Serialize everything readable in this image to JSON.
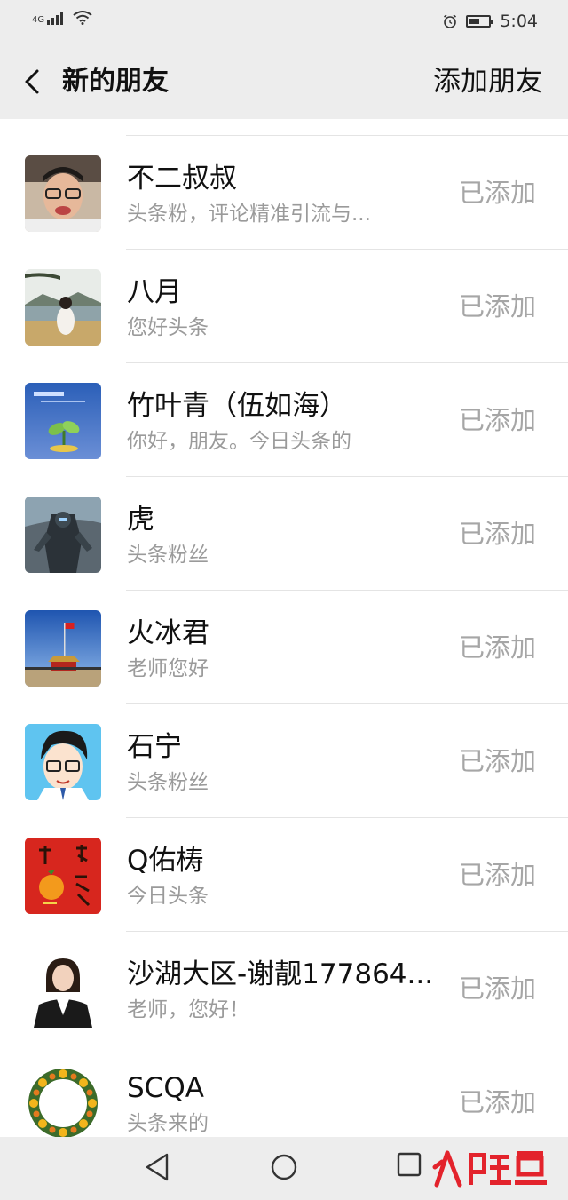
{
  "status_bar": {
    "network": "4G",
    "time": "5:04",
    "battery_level": 0.55
  },
  "nav": {
    "back_icon": "chevron-left-icon",
    "title": "新的朋友",
    "action": "添加朋友"
  },
  "contacts": [
    {
      "name": "不二叔叔",
      "message": "头条粉，评论精准引流与...",
      "status": "已添加",
      "avatar": "man-glasses-photo"
    },
    {
      "name": "八月",
      "message": "您好头条",
      "status": "已添加",
      "avatar": "woman-lakeside-photo"
    },
    {
      "name": "竹叶青（伍如海）",
      "message": "你好，朋友。今日头条的",
      "status": "已添加",
      "avatar": "blue-sprout-picture"
    },
    {
      "name": "虎",
      "message": "头条粉丝",
      "status": "已添加",
      "avatar": "robot-figure-picture"
    },
    {
      "name": "火冰君",
      "message": "老师您好",
      "status": "已添加",
      "avatar": "tiananmen-sky-photo"
    },
    {
      "name": "石宁",
      "message": "头条粉丝",
      "status": "已添加",
      "avatar": "cartoon-boy-glasses"
    },
    {
      "name": "Q佑梼",
      "message": "今日头条",
      "status": "已添加",
      "avatar": "red-fortune-orange"
    },
    {
      "name": "沙湖大区-谢靓177864...",
      "message": "老师，您好！",
      "status": "已添加",
      "avatar": "woman-suit-photo"
    },
    {
      "name": "SCQA",
      "message": "头条来的",
      "status": "已添加",
      "avatar": "flower-wreath-picture"
    }
  ],
  "system_nav": {
    "back": "triangle-back-icon",
    "home": "circle-home-icon",
    "recent": "square-recent-icon"
  },
  "watermark": {
    "text": "人鲤鱼"
  },
  "colors": {
    "bar_bg": "#ededed",
    "secondary_text": "#9a9a9a",
    "status_text": "#a6a6a6",
    "divider": "#e4e4e4",
    "watermark_red": "#e3232c"
  }
}
